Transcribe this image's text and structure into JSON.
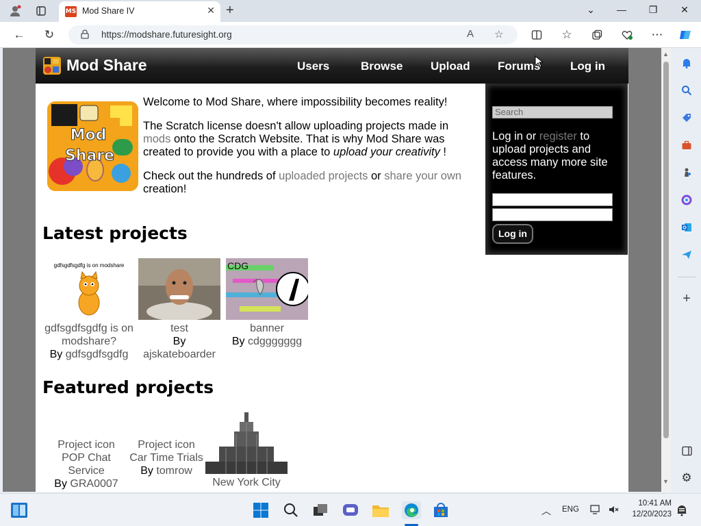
{
  "browser": {
    "tab_title": "Mod Share IV",
    "tab_icon_text": "MS",
    "url": "https://modshare.futuresight.org"
  },
  "site": {
    "logo_text": "Mod Share",
    "menu": [
      "Users",
      "Browse",
      "Upload",
      "Forums",
      "Log in"
    ],
    "intro": {
      "welcome": "Welcome to Mod Share, where impossibility becomes reality!",
      "p2_a": "The Scratch license doesn't allow uploading projects made in ",
      "p2_link": "mods",
      "p2_b": " onto the Scratch Website. That is why Mod Share was created to provide you with a place to ",
      "p2_em": "upload your creativity",
      "p2_c": " !",
      "p3_a": "Check out the hundreds of ",
      "p3_link1": "uploaded projects",
      "p3_b": " or ",
      "p3_link2": "share your own",
      "p3_c": " creation!"
    },
    "latest_heading": "Latest projects",
    "latest": [
      {
        "title": "gdfsgdfsgdfg is on modshare?",
        "by": "By ",
        "author": "gdfsgdfsgdfg",
        "thumb_caption": "gdfsgdfsgdfg is on modshare"
      },
      {
        "title": "test",
        "by": "By ",
        "author": "ajskateboarder"
      },
      {
        "title": "banner",
        "by": "By ",
        "author": "cdggggggg",
        "thumb_caption": "CDG"
      }
    ],
    "featured_heading": "Featured projects",
    "featured": [
      {
        "alt": "Project icon",
        "title": "POP Chat Service",
        "by": "By ",
        "author": "GRA0007"
      },
      {
        "alt": "Project icon",
        "title": "Car Time Trials",
        "by": "By ",
        "author": "tomrow"
      },
      {
        "title": "New York City"
      }
    ],
    "login": {
      "search_placeholder": "Search",
      "text_a": "Log in or ",
      "register": "register",
      "text_b": " to upload projects and access many more site features.",
      "button": "Log in"
    }
  },
  "taskbar": {
    "lang": "ENG",
    "time": "10:41 AM",
    "date": "12/20/2023"
  },
  "colors": {
    "brand_orange": "#f3a41a",
    "link_gray": "#777777",
    "edge_blue": "#0a63c9"
  }
}
